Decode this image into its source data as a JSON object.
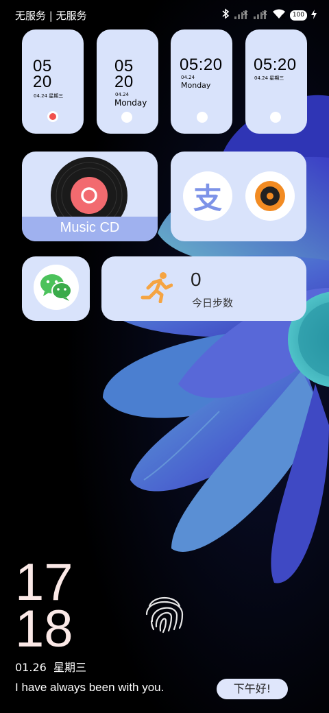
{
  "status_bar": {
    "carrier": "无服务 | 无服务",
    "battery": "100",
    "icons": [
      "bluetooth-icon",
      "signal-icon",
      "signal-icon",
      "wifi-icon",
      "battery-icon",
      "charging-icon"
    ]
  },
  "clock_widgets": [
    {
      "hour": "05",
      "minute": "20",
      "date": "04.24",
      "weekday": "星期三",
      "indicator": "red"
    },
    {
      "hour": "05",
      "minute": "20",
      "date": "04.24",
      "weekday": "Monday",
      "indicator": "white"
    },
    {
      "time": "05:20",
      "date": "04.24",
      "weekday": "Monday",
      "indicator": "white"
    },
    {
      "time": "05:20",
      "date": "04.24",
      "weekday": "星期三",
      "indicator": "white"
    }
  ],
  "music_widget": {
    "label": "Music CD",
    "icon": "vinyl-record-icon"
  },
  "app_shortcuts": [
    {
      "name": "alipay-icon",
      "glyph": "支",
      "color": "#7d93e8"
    },
    {
      "name": "music-app-icon",
      "color": "#f28b22"
    }
  ],
  "wechat_widget": {
    "icon": "wechat-icon",
    "color": "#4bc25b"
  },
  "steps_widget": {
    "count": "0",
    "label": "今日步数",
    "icon": "running-person-icon",
    "color": "#f5a442"
  },
  "lock_screen": {
    "hour": "17",
    "minute": "18",
    "date": "01.26  星期三",
    "message": "I have always been with you.",
    "greeting": "下午好!"
  },
  "fingerprint": {
    "icon": "fingerprint-icon"
  }
}
